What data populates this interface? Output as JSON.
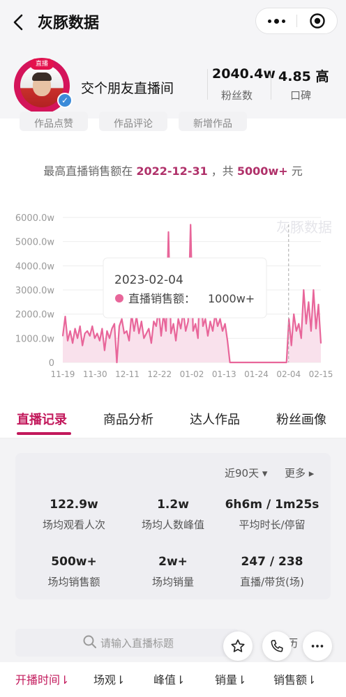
{
  "app": {
    "title": "灰豚数据"
  },
  "profile": {
    "name": "交个朋友直播间",
    "avatar_badge": "直播",
    "fans_value": "2040.4w",
    "fans_label": "粉丝数",
    "reputation_value": "4.85 高",
    "reputation_label": "口碑"
  },
  "chips": [
    "作品点赞",
    "作品评论",
    "新增作品"
  ],
  "peak": {
    "prefix": "最高直播销售额在",
    "date": "2022-12-31",
    "middle": "，共",
    "amount": "5000w+",
    "unit": "元"
  },
  "chart_data": {
    "type": "area",
    "title": "",
    "xlabel": "",
    "ylabel": "",
    "ylim": [
      0,
      6000
    ],
    "y_ticks": [
      "0",
      "1000.0w",
      "2000.0w",
      "3000.0w",
      "4000.0w",
      "5000.0w",
      "6000.0w"
    ],
    "x_ticks": [
      "11-19",
      "11-30",
      "12-11",
      "12-22",
      "01-02",
      "01-13",
      "01-24",
      "02-04",
      "02-15"
    ],
    "tooltip": {
      "date": "2023-02-04",
      "label": "直播销售额：",
      "value": "1000w+"
    },
    "watermark": "灰豚数据",
    "series": [
      {
        "color": "#e8669a",
        "values": [
          1100,
          1900,
          900,
          1300,
          800,
          1400,
          1000,
          1500,
          700,
          1200,
          1300,
          1100,
          1500,
          1000,
          1200,
          900,
          1400,
          500,
          1300,
          1000,
          1400,
          1600,
          0,
          1500,
          1800,
          1200,
          1300,
          900,
          2000,
          1300,
          1900,
          1200,
          1700,
          1000,
          1200,
          1400,
          800,
          1700,
          1500,
          2200,
          1100,
          2000,
          1300,
          5400,
          1200,
          1600,
          900,
          1800,
          1400,
          2100,
          1300,
          1700,
          5700,
          1300,
          1600,
          1000,
          3900,
          1500,
          1800,
          1100,
          1700,
          1300,
          2000,
          1500,
          1800,
          1300,
          1600,
          900,
          0,
          0,
          0,
          0,
          0,
          0,
          0,
          0,
          0,
          0,
          0,
          0,
          0,
          0,
          0,
          0,
          0,
          0,
          0,
          0,
          0,
          0,
          0,
          0,
          1800,
          700,
          2000,
          1300,
          1600,
          1000,
          3000,
          1600,
          2500,
          1300,
          3000,
          1400,
          2400,
          800
        ]
      }
    ]
  },
  "tabs": [
    "直播记录",
    "商品分析",
    "达人作品",
    "粉丝画像"
  ],
  "stats": {
    "range": "近90天 ▾",
    "more": "更多 ▸",
    "items": [
      {
        "value": "122.9w",
        "label": "场均观看人次"
      },
      {
        "value": "1.2w",
        "label": "场均人数峰值"
      },
      {
        "value": "6h6m / 1m25s",
        "label": "平均时长/停留"
      },
      {
        "value": "500w+",
        "label": "场均销售额"
      },
      {
        "value": "2w+",
        "label": "场均销量"
      },
      {
        "value": "247 / 238",
        "label": "直播/带货(场)"
      }
    ]
  },
  "search": {
    "placeholder": "请输入直播标题",
    "history": "历"
  },
  "sort_columns": [
    "开播时间",
    "场观",
    "峰值",
    "销量",
    "销售额"
  ],
  "colors": {
    "accent": "#c2185b",
    "chart": "#e8669a"
  }
}
